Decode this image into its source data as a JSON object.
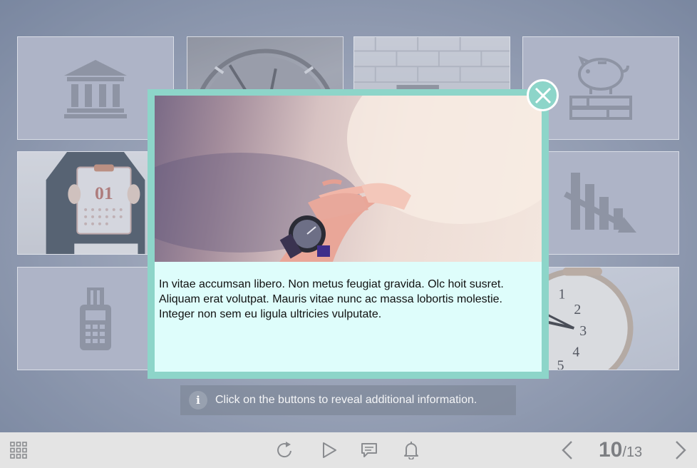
{
  "popup": {
    "text": "In vitae accumsan libero. Non metus feugiat gravida. Olc hoit susret. Aliquam erat volutpat. Mauris vitae nunc ac massa lobortis molestie. Integer non sem eu ligula ultricies vulputate."
  },
  "tiles": {
    "calendar_day": "01",
    "clock_numbers": [
      "1",
      "2",
      "3",
      "4",
      "5"
    ]
  },
  "info": {
    "icon_glyph": "i",
    "text": "Click on the buttons to reveal additional information."
  },
  "toolbar": {
    "page_current": "10",
    "page_separator": "/",
    "page_total": "13"
  },
  "icons": [
    "bank-icon",
    "piggy-bank-icon",
    "declining-chart-icon",
    "card-terminal-icon",
    "close-icon",
    "grid-menu-icon",
    "replay-icon",
    "play-icon",
    "chat-icon",
    "bell-icon",
    "chevron-left-icon",
    "chevron-right-icon"
  ],
  "colors": {
    "popup_border": "#8dd5c9",
    "popup_background": "#defdfb",
    "toolbar_background": "#e4e4e4"
  }
}
